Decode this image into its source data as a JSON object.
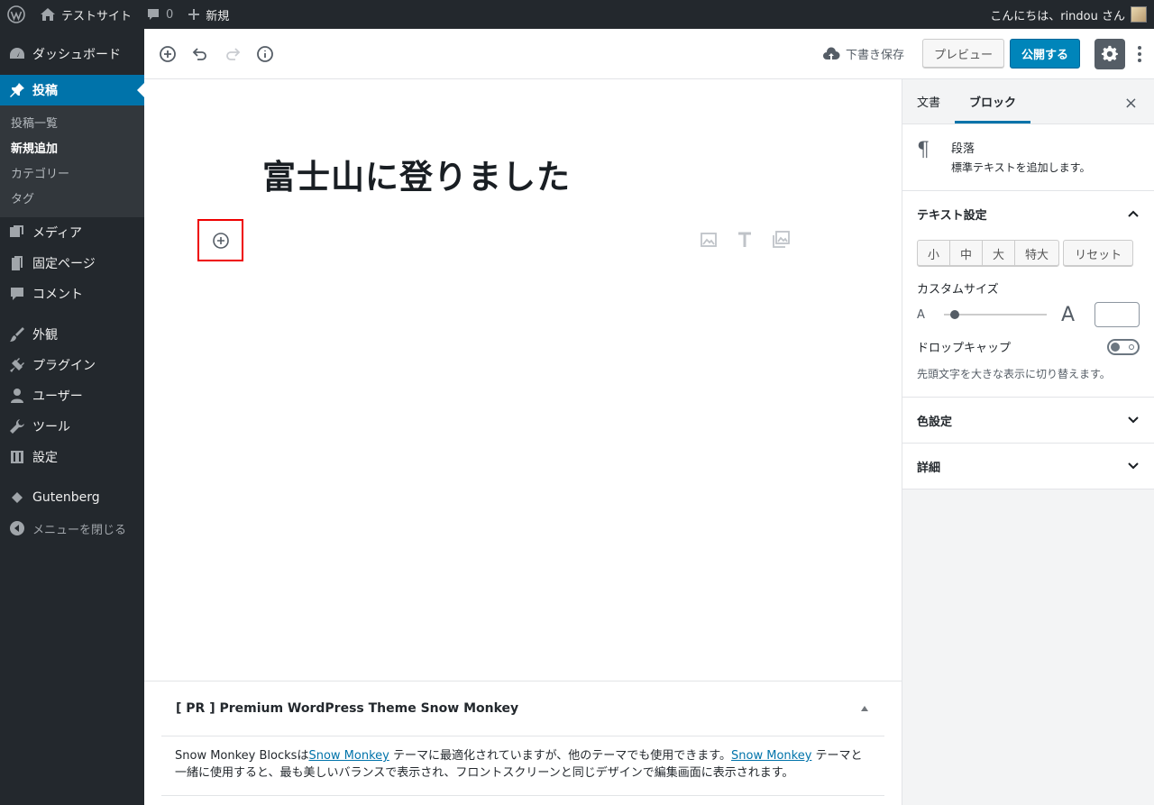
{
  "admin_bar": {
    "site_name": "テストサイト",
    "comments_count": "0",
    "new_label": "新規",
    "greeting": "こんにちは、rindou さん"
  },
  "admin_menu": {
    "dashboard": "ダッシュボード",
    "posts": "投稿",
    "posts_submenu": [
      "投稿一覧",
      "新規追加",
      "カテゴリー",
      "タグ"
    ],
    "media": "メディア",
    "pages": "固定ページ",
    "comments": "コメント",
    "appearance": "外観",
    "plugins": "プラグイン",
    "users": "ユーザー",
    "tools": "ツール",
    "settings": "設定",
    "gutenberg": "Gutenberg",
    "collapse": "メニューを閉じる"
  },
  "editor_header": {
    "save_draft": "下書き保存",
    "preview": "プレビュー",
    "publish": "公開する"
  },
  "content": {
    "post_title": "富士山に登りました"
  },
  "metabox": {
    "title": "[ PR ] Premium WordPress Theme Snow Monkey",
    "body_1": "Snow Monkey Blocksは",
    "link_1": "Snow Monkey",
    "body_2": " テーマに最適化されていますが、他のテーマでも使用できます。",
    "link_2": "Snow Monkey",
    "body_3": " テーマと一緒に使用すると、最も美しいバランスで表示され、フロントスクリーンと同じデザインで編集画面に表示されます。"
  },
  "sidebar": {
    "tab_document": "文書",
    "tab_block": "ブロック",
    "close": "×",
    "block_name": "段落",
    "block_description": "標準テキストを追加します。",
    "text_settings": "テキスト設定",
    "sizes": [
      "小",
      "中",
      "大",
      "特大"
    ],
    "reset": "リセット",
    "custom_size": "カスタムサイズ",
    "slider_small_label": "A",
    "slider_large_label": "A",
    "drop_cap": "ドロップキャップ",
    "drop_cap_help": "先頭文字を大きな表示に切り替えます。",
    "color_settings": "色設定",
    "advanced": "詳細"
  },
  "colors": {
    "admin_dark": "#23282d",
    "accent_blue": "#0073aa",
    "publish_blue": "#0085ba",
    "highlight_red": "#e00000"
  }
}
